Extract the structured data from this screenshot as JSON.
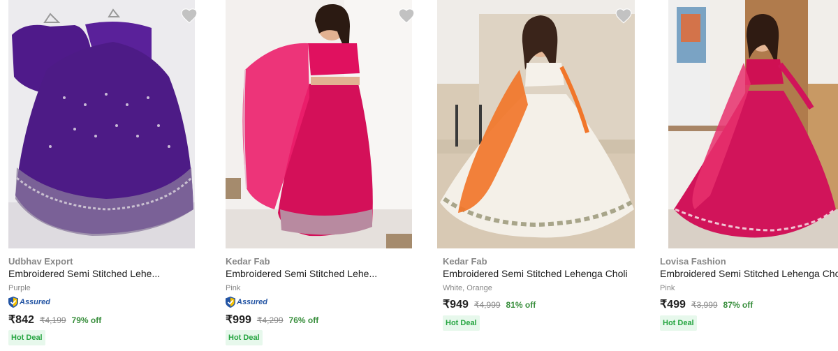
{
  "products": [
    {
      "brand": "Udbhav Export",
      "title": "Embroidered Semi Stitched Lehe...",
      "color": "Purple",
      "assured_label": "Assured",
      "price": "₹842",
      "mrp": "₹4,199",
      "discount": "79% off",
      "badge": "Hot Deal"
    },
    {
      "brand": "Kedar Fab",
      "title": "Embroidered Semi Stitched Lehe...",
      "color": "Pink",
      "assured_label": "Assured",
      "price": "₹999",
      "mrp": "₹4,299",
      "discount": "76% off",
      "badge": "Hot Deal"
    },
    {
      "brand": "Kedar Fab",
      "title": "Embroidered Semi Stitched Lehenga Choli",
      "color": "White, Orange",
      "price": "₹949",
      "mrp": "₹4,999",
      "discount": "81% off",
      "badge": "Hot Deal"
    },
    {
      "brand": "Lovisa Fashion",
      "title": "Embroidered Semi Stitched Lehenga Choli",
      "color": "Pink",
      "price": "₹499",
      "mrp": "₹3,999",
      "discount": "87% off",
      "badge": "Hot Deal"
    }
  ],
  "icons": {
    "wishlist": "heart-icon",
    "assured": "shield-check-icon"
  },
  "colors": {
    "price_discount": "#388e3c",
    "assured_blue": "#2455a4",
    "hot_deal_bg": "#e7f8ec",
    "hot_deal_text": "#26a541",
    "muted": "#878787"
  }
}
